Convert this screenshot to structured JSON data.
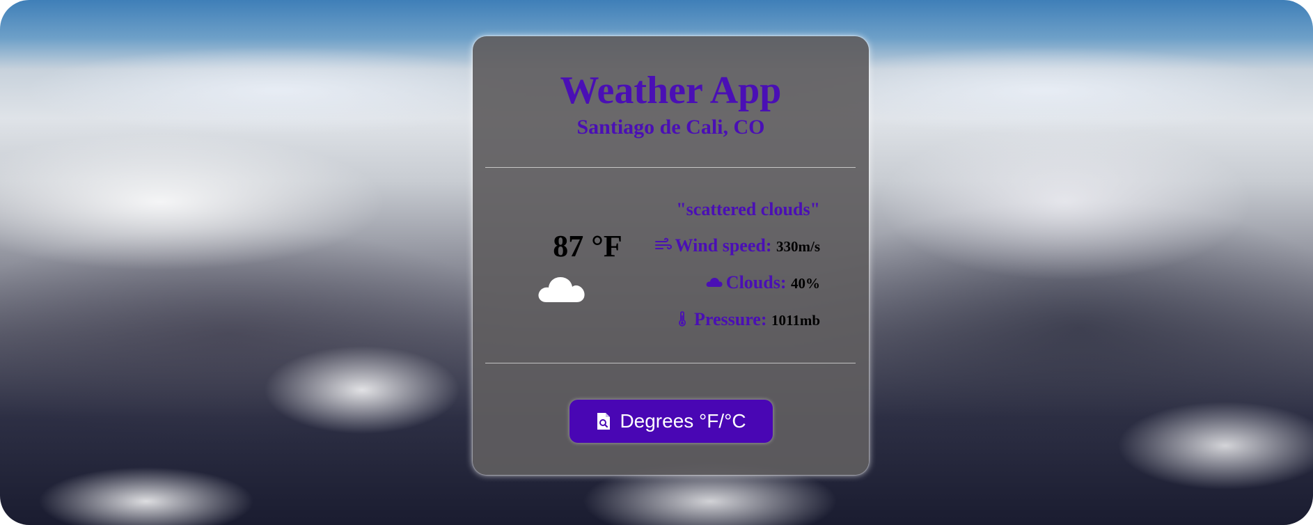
{
  "app": {
    "title": "Weather App",
    "location": "Santiago de Cali, CO"
  },
  "weather": {
    "temperature": "87 °F",
    "description": "\"scattered clouds\"",
    "condition_icon": "cloud-icon",
    "details": [
      {
        "icon": "wind-icon",
        "label": "Wind speed:",
        "value": "330m/s"
      },
      {
        "icon": "cloud-icon",
        "label": "Clouds:",
        "value": "40%"
      },
      {
        "icon": "thermometer-icon",
        "label": "Pressure:",
        "value": "1011mb"
      }
    ]
  },
  "actions": {
    "toggle_units_label": "Degrees °F/°C",
    "toggle_units_icon": "file-search-icon"
  },
  "colors": {
    "accent": "#4a0fb5",
    "button": "#4906b4",
    "card": "#5f5d5f"
  }
}
